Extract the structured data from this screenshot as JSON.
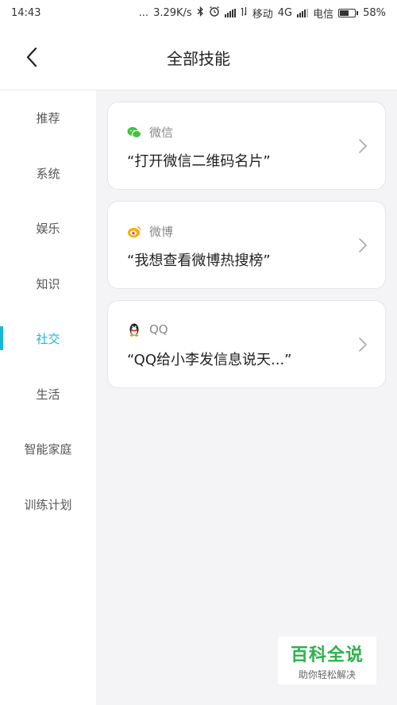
{
  "status_bar": {
    "time": "14:43",
    "dots": "...",
    "speed": "3.29K/s",
    "carrier1": "移动",
    "network": "4G",
    "carrier2": "电信",
    "battery_percent": "58%",
    "battery_level": 0.58,
    "icons": [
      "bluetooth-icon",
      "alarm-icon",
      "signal-icon",
      "data-arrows-icon",
      "signal-icon",
      "battery-icon"
    ]
  },
  "header": {
    "title": "全部技能",
    "back_icon": "chevron-left-icon"
  },
  "sidebar": {
    "items": [
      {
        "label": "推荐"
      },
      {
        "label": "系统"
      },
      {
        "label": "娱乐"
      },
      {
        "label": "知识"
      },
      {
        "label": "社交"
      },
      {
        "label": "生活"
      },
      {
        "label": "智能家庭"
      },
      {
        "label": "训练计划"
      }
    ],
    "active_index": 4,
    "accent_color": "#18b6d9"
  },
  "cards": [
    {
      "app": "微信",
      "icon": "wechat-icon",
      "quote": "“打开微信二维码名片”"
    },
    {
      "app": "微博",
      "icon": "weibo-icon",
      "quote": "“我想查看微博热搜榜”"
    },
    {
      "app": "QQ",
      "icon": "qq-penguin-icon",
      "quote": "“QQ给小李发信息说天...”"
    }
  ],
  "watermark": {
    "title": "百科全说",
    "subtitle": "助你轻松解决",
    "color": "#2bb24c"
  }
}
